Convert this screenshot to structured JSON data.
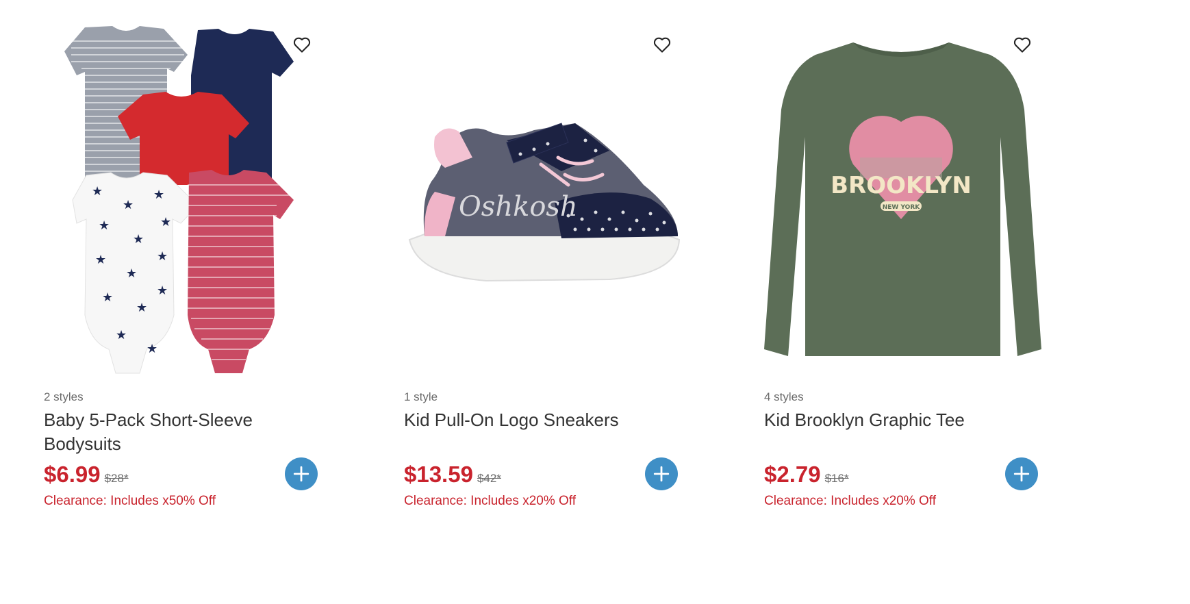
{
  "products": [
    {
      "styles": "2 styles",
      "title": "Baby 5-Pack Short-Sleeve Bodysuits",
      "price": "$6.99",
      "was_price": "$28*",
      "promo": "Clearance: Includes x50% Off",
      "image": "baby-bodysuits-5-pack"
    },
    {
      "styles": "1 style",
      "title": "Kid Pull-On Logo Sneakers",
      "price": "$13.59",
      "was_price": "$42*",
      "promo": "Clearance: Includes x20% Off",
      "image": "pull-on-logo-sneaker",
      "logo_text": "Oshkosh"
    },
    {
      "styles": "4 styles",
      "title": "Kid Brooklyn Graphic Tee",
      "price": "$2.79",
      "was_price": "$16*",
      "promo": "Clearance: Includes x20% Off",
      "image": "brooklyn-graphic-tee",
      "graphic_text": "BROOKLYN",
      "graphic_subtext": "NEW YORK"
    }
  ],
  "icons": {
    "favorite": "heart-outline-icon",
    "add": "plus-icon"
  },
  "colors": {
    "sale_red": "#c9232d",
    "add_blue": "#3f8fc6",
    "muted": "#6b6b6b"
  }
}
